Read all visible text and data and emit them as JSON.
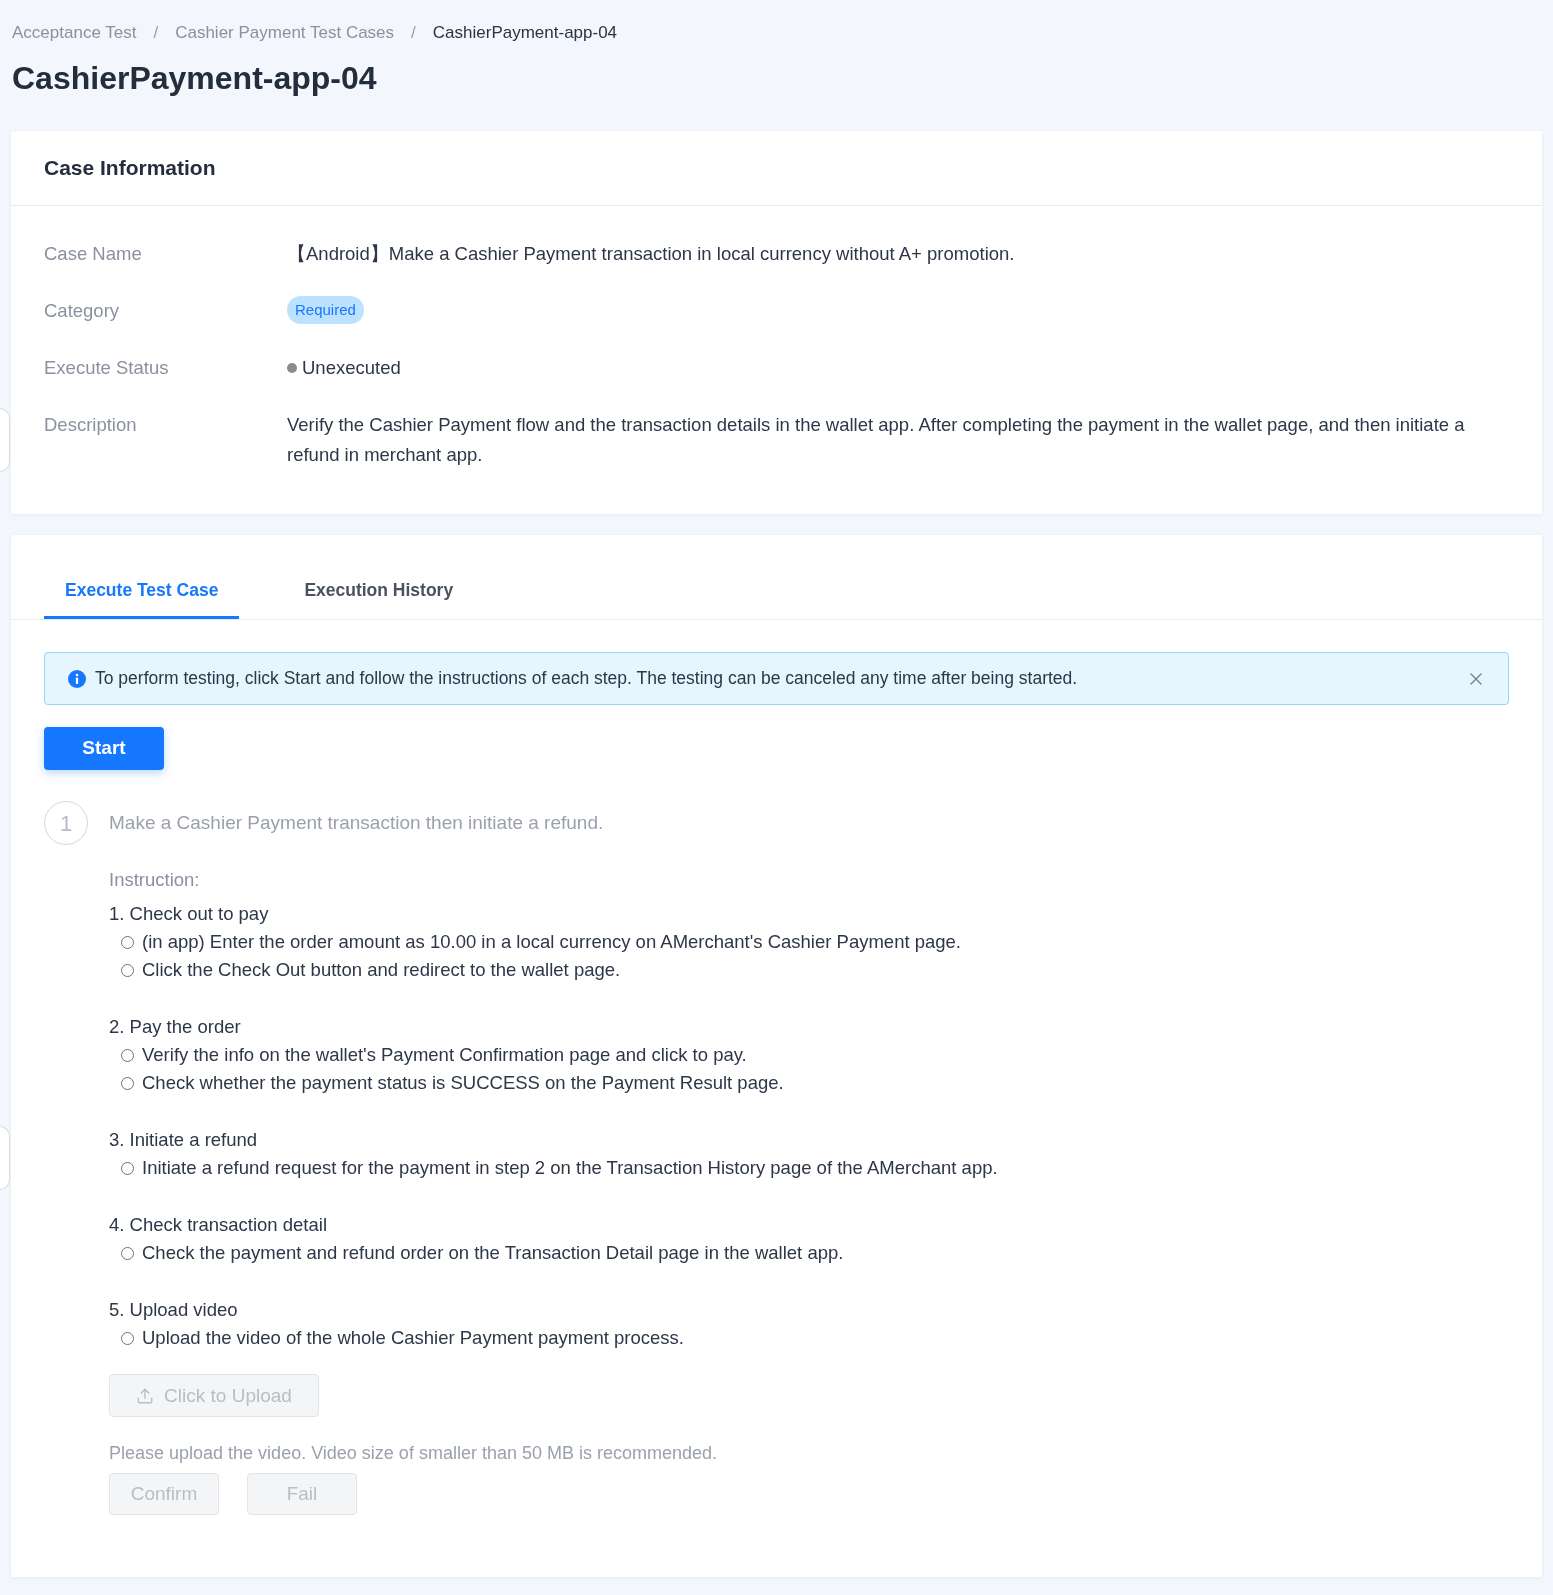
{
  "breadcrumb": [
    {
      "kind": "link",
      "text": "Acceptance Test"
    },
    {
      "kind": "separator",
      "text": "/"
    },
    {
      "kind": "link",
      "text": "Cashier Payment Test Cases"
    },
    {
      "kind": "separator",
      "text": "/"
    },
    {
      "kind": "current",
      "text": "CashierPayment-app-04"
    }
  ],
  "page_title": "CashierPayment-app-04",
  "case_information": {
    "title": "Case Information",
    "fields": [
      {
        "kind": "text",
        "label": "Case Name",
        "value": "【Android】Make a Cashier Payment transaction in local currency without A+ promotion."
      },
      {
        "kind": "tag",
        "label": "Category",
        "value": "Required"
      },
      {
        "kind": "status",
        "label": "Execute Status",
        "value": "Unexecuted",
        "color": "#8c8c8c"
      },
      {
        "kind": "text",
        "label": "Description",
        "value": "Verify the Cashier Payment flow and the transaction details in the wallet app. After completing the payment in the wallet page, and then initiate a refund in merchant app."
      }
    ]
  },
  "tabs": [
    {
      "label": "Execute Test Case",
      "selected": true
    },
    {
      "label": "Execution History",
      "selected": false
    }
  ],
  "alert": {
    "text": "To perform testing, click Start and follow the instructions of each step. The testing can be canceled any time after being started."
  },
  "start_button": {
    "label": "Start",
    "disabled": false
  },
  "steps": [
    {
      "number": "1",
      "active": false,
      "title": "Make a Cashier Payment transaction then initiate a refund.",
      "instruction_label": "Instruction:",
      "groups": [
        {
          "heading": "1. Check out to pay",
          "items": [
            {
              "text": "(in app) Enter the order amount as 10.00 in a local currency on AMerchant's Cashier Payment page.",
              "checked": false
            },
            {
              "text": "Click the Check Out button and redirect to the wallet page.",
              "checked": false
            }
          ]
        },
        {
          "heading": "2. Pay the order",
          "items": [
            {
              "text": "Verify the info on the wallet's Payment Confirmation page and click to pay.",
              "checked": false
            },
            {
              "text": "Check whether the payment status is SUCCESS on the Payment Result page.",
              "checked": false
            }
          ]
        },
        {
          "heading": "3. Initiate a refund",
          "items": [
            {
              "text": "Initiate a refund request for the payment in step 2 on the Transaction History page of the AMerchant app.",
              "checked": false
            }
          ]
        },
        {
          "heading": "4. Check transaction detail",
          "items": [
            {
              "text": "Check the payment and refund order on the Transaction Detail page in the wallet app.",
              "checked": false
            }
          ]
        },
        {
          "heading": "5. Upload video",
          "items": [
            {
              "text": "Upload the video of the whole Cashier Payment payment process.",
              "checked": false
            }
          ]
        }
      ],
      "upload_button": {
        "label": "Click to Upload",
        "disabled": true
      },
      "hint": "Please upload the video. Video size of smaller than 50 MB is recommended.",
      "actions": [
        {
          "label": "Confirm",
          "disabled": true
        },
        {
          "label": "Fail",
          "disabled": true
        }
      ]
    }
  ]
}
